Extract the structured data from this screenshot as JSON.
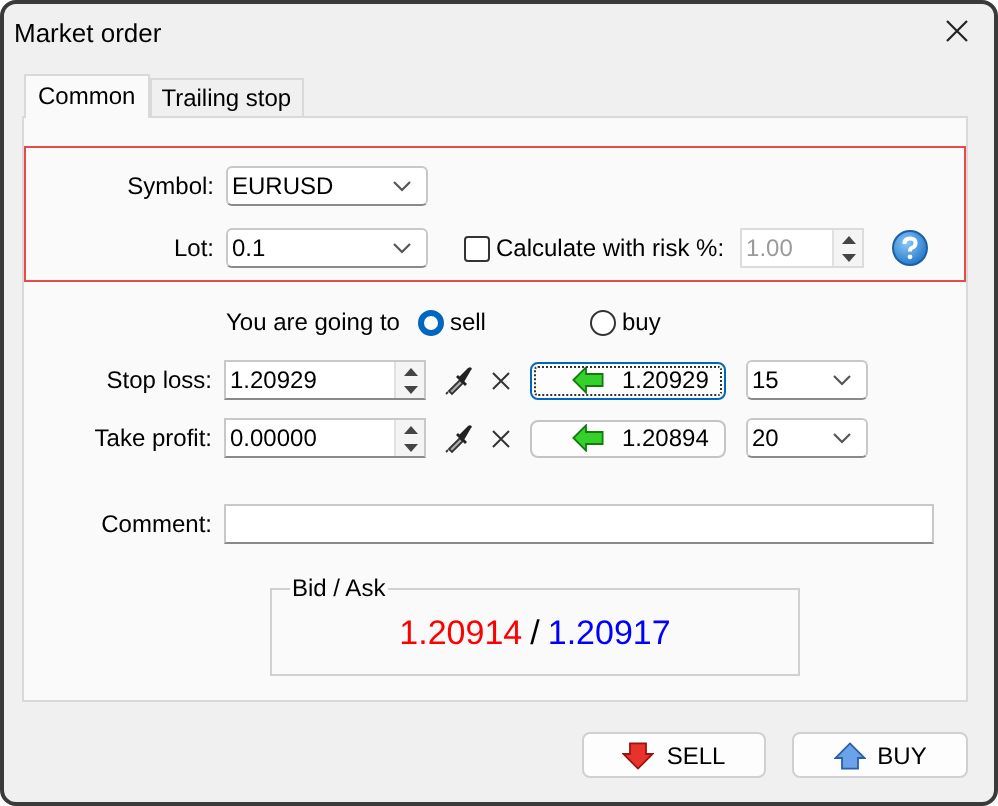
{
  "window": {
    "title": "Market order"
  },
  "tabs": [
    {
      "label": "Common",
      "selected": true
    },
    {
      "label": "Trailing stop",
      "selected": false
    }
  ],
  "symbol": {
    "label": "Symbol:",
    "value": "EURUSD"
  },
  "lot": {
    "label": "Lot:",
    "value": "0.1"
  },
  "risk": {
    "label": "Calculate with risk %:",
    "checked": false,
    "value": "1.00",
    "disabled": true
  },
  "direction": {
    "label": "You are going to",
    "options": [
      {
        "label": "sell",
        "selected": true
      },
      {
        "label": "buy",
        "selected": false
      }
    ]
  },
  "levels": [
    {
      "label": "Stop loss:",
      "value": "1.20929",
      "price": "1.20929",
      "focused": true,
      "points": "15"
    },
    {
      "label": "Take profit:",
      "value": "0.00000",
      "price": "1.20894",
      "focused": false,
      "points": "20"
    }
  ],
  "comment": {
    "label": "Comment:"
  },
  "quote": {
    "title": "Bid / Ask",
    "bid": "1.20914",
    "separator": "/",
    "ask": "1.20917"
  },
  "buttons": [
    {
      "label": "SELL",
      "kind": "sell"
    },
    {
      "label": "BUY",
      "kind": "buy"
    }
  ]
}
